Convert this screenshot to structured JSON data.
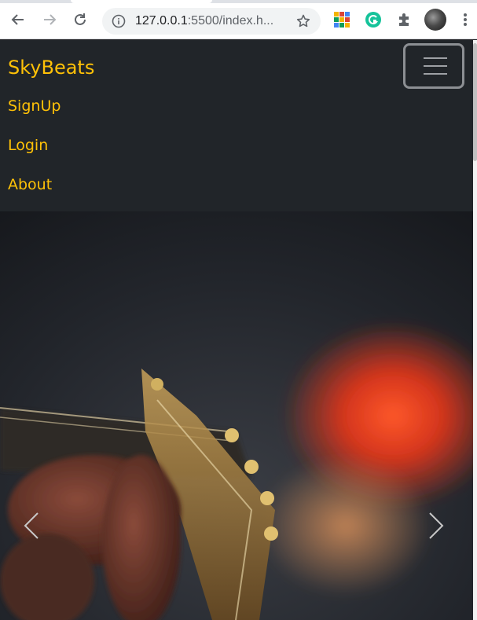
{
  "browser": {
    "url_host": "127.0.0.1",
    "url_rest": ":5500/index.h...",
    "icons": {
      "back": "back-arrow-icon",
      "forward": "forward-arrow-icon",
      "reload": "reload-icon",
      "info": "info-icon",
      "bookmark": "star-icon",
      "extension1": "extension-grid-icon",
      "extension2": "grammarly-icon",
      "extensions": "puzzle-icon",
      "profile": "avatar",
      "menu": "kebab-menu-icon"
    }
  },
  "navbar": {
    "brand": "SkyBeats",
    "links": [
      {
        "label": "SignUp"
      },
      {
        "label": "Login"
      },
      {
        "label": "About"
      }
    ],
    "toggler_icon": "hamburger-icon"
  },
  "carousel": {
    "prev_icon": "chevron-left-icon",
    "next_icon": "chevron-right-icon",
    "slide_description_icon": "guitar-slide-image"
  },
  "colors": {
    "navbar_bg": "#212529",
    "brand_color": "#ffc107",
    "link_color": "#ffc107",
    "toggler_border": "#8c8f93"
  }
}
